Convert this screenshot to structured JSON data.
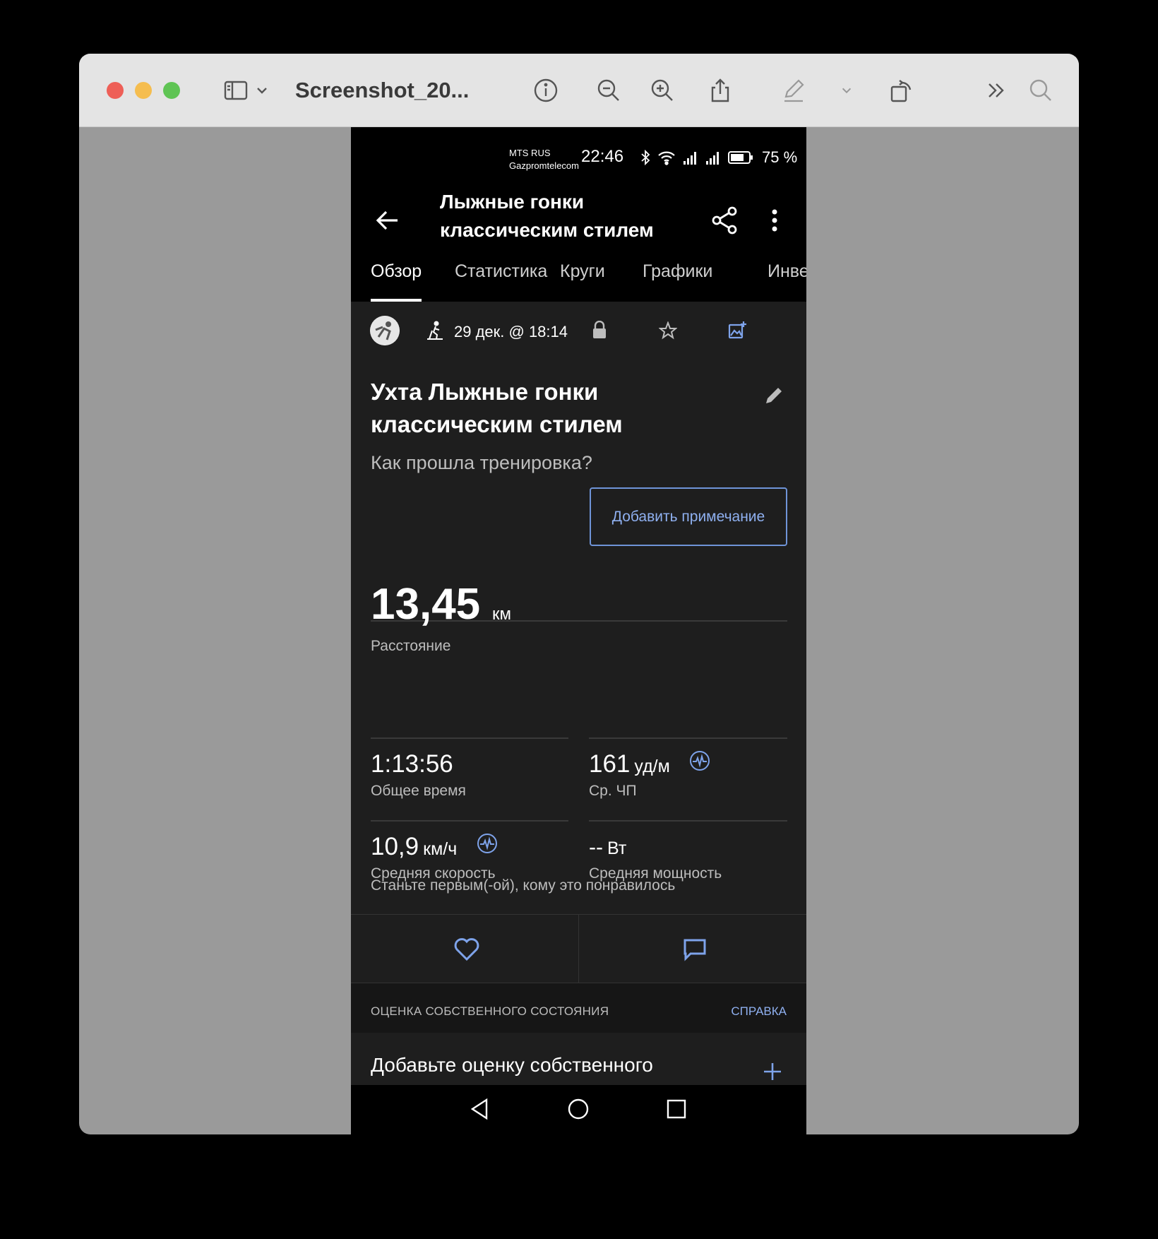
{
  "window": {
    "title": "Screenshot_20...",
    "icons": [
      "sidebar-icon",
      "chevron-down-icon",
      "info-icon",
      "zoom-out-icon",
      "zoom-in-icon",
      "share-icon",
      "markup-pen-icon",
      "rotate-icon",
      "more-chevron-icon",
      "search-icon"
    ]
  },
  "status_bar": {
    "carrier_1": "MTS RUS",
    "carrier_2": "Gazpromtelecom",
    "time": "22:46",
    "battery": "75 %"
  },
  "app_bar": {
    "title": "Лыжные гонки классическим стилем"
  },
  "tabs": [
    {
      "label": "Обзор",
      "active": true
    },
    {
      "label": "Статистика",
      "active": false
    },
    {
      "label": "Круги",
      "active": false
    },
    {
      "label": "Графики",
      "active": false
    },
    {
      "label": "Инве",
      "active": false
    }
  ],
  "activity": {
    "date": "29 дек. @ 18:14",
    "title": "Ухта Лыжные гонки классическим стилем",
    "question": "Как прошла тренировка?",
    "add_note": "Добавить примечание"
  },
  "stats": {
    "distance": {
      "value": "13,45",
      "unit": "км",
      "label": "Расстояние"
    },
    "total_time": {
      "value": "1:13:56",
      "label": "Общее время"
    },
    "avg_hr": {
      "value": "161",
      "unit": "уд/м",
      "label": "Ср. ЧП"
    },
    "avg_speed": {
      "value": "10,9",
      "unit": "км/ч",
      "label": "Средняя скорость"
    },
    "avg_power": {
      "value": "--",
      "unit": "Вт",
      "label": "Средняя мощность"
    }
  },
  "social": {
    "likes_prompt": "Станьте первым(-ой), кому это понравилось"
  },
  "self_evaluation": {
    "section_title": "ОЦЕНКА СОБСТВЕННОГО СОСТОЯНИЯ",
    "help_link": "СПРАВКА",
    "prompt": "Добавьте оценку собственного"
  },
  "colors": {
    "accent": "#6f94d8",
    "background": "#1e1e1e",
    "header": "#000000"
  }
}
